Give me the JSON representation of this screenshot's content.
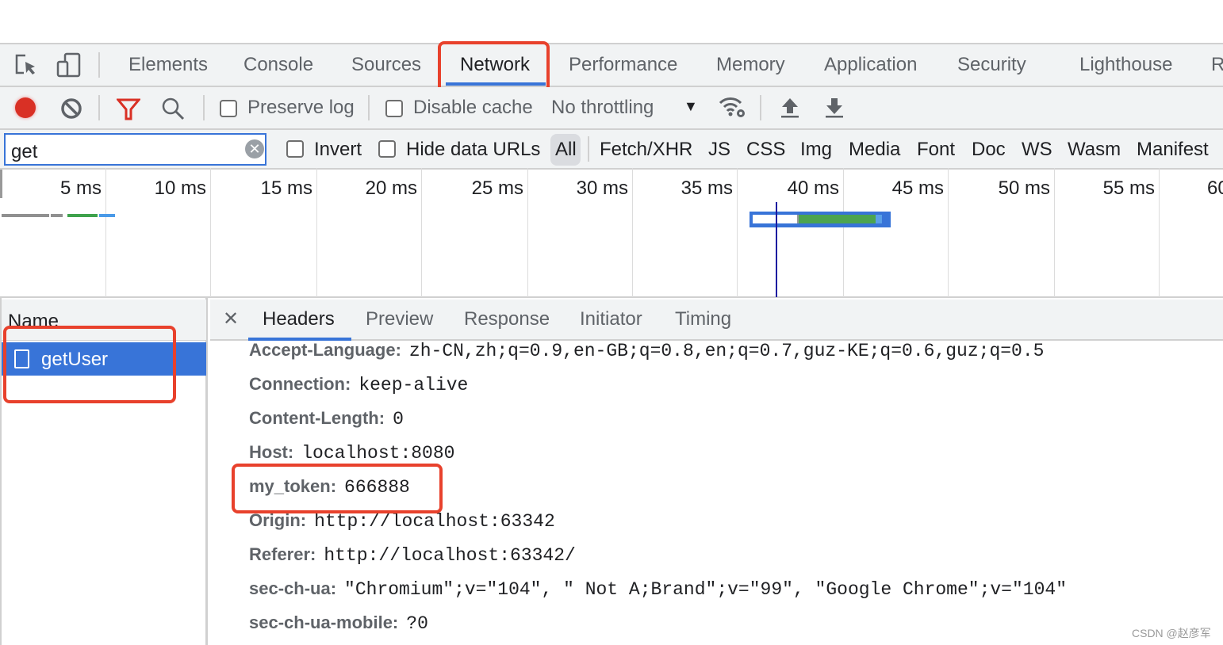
{
  "main_tabs": [
    "Elements",
    "Console",
    "Sources",
    "Network",
    "Performance",
    "Memory",
    "Application",
    "Security",
    "Lighthouse",
    "R"
  ],
  "active_tab": "Network",
  "toolbar": {
    "preserve_log": "Preserve log",
    "disable_cache": "Disable cache",
    "throttling": "No throttling"
  },
  "filter": {
    "value": "get",
    "invert": "Invert",
    "hide_data_urls": "Hide data URLs",
    "types": [
      "All",
      "Fetch/XHR",
      "JS",
      "CSS",
      "Img",
      "Media",
      "Font",
      "Doc",
      "WS",
      "Wasm",
      "Manifest"
    ]
  },
  "timeline": {
    "ticks": [
      "5 ms",
      "10 ms",
      "15 ms",
      "20 ms",
      "25 ms",
      "30 ms",
      "35 ms",
      "40 ms",
      "45 ms",
      "50 ms",
      "55 ms",
      "60"
    ]
  },
  "requests": {
    "header": "Name",
    "items": [
      "getUser"
    ]
  },
  "details": {
    "tabs": [
      "Headers",
      "Preview",
      "Response",
      "Initiator",
      "Timing"
    ],
    "active": "Headers",
    "headers": [
      {
        "k": "Accept-Language:",
        "v": "zh-CN,zh;q=0.9,en-GB;q=0.8,en;q=0.7,guz-KE;q=0.6,guz;q=0.5"
      },
      {
        "k": "Connection:",
        "v": "keep-alive"
      },
      {
        "k": "Content-Length:",
        "v": "0"
      },
      {
        "k": "Host:",
        "v": "localhost:8080"
      },
      {
        "k": "my_token:",
        "v": "666888"
      },
      {
        "k": "Origin:",
        "v": "http://localhost:63342"
      },
      {
        "k": "Referer:",
        "v": "http://localhost:63342/"
      },
      {
        "k": "sec-ch-ua:",
        "v": "\"Chromium\";v=\"104\", \" Not A;Brand\";v=\"99\", \"Google Chrome\";v=\"104\""
      },
      {
        "k": "sec-ch-ua-mobile:",
        "v": "?0"
      }
    ]
  },
  "watermark": "CSDN @赵彦军",
  "colors": {
    "accent": "#3874d8",
    "highlight": "#e8412c",
    "record": "#d93025"
  }
}
